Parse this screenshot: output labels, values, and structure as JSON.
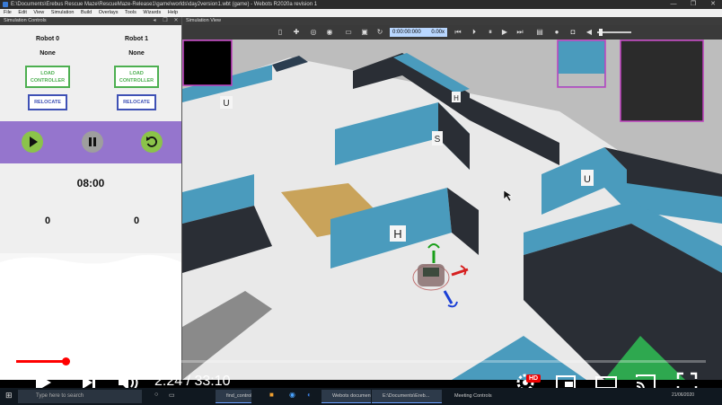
{
  "window": {
    "title": "E:\\Documents\\Erebus Rescue Maze\\RescueMaze-Release1\\game\\worlds\\day2version1.wbt (game) - Webots R2020a revision 1",
    "minimize": "—",
    "maximize": "❐",
    "close": "✕"
  },
  "menu": [
    "File",
    "Edit",
    "View",
    "Simulation",
    "Build",
    "Overlays",
    "Tools",
    "Wizards",
    "Help"
  ],
  "left_panel": {
    "header": "Simulation Controls",
    "robots": [
      {
        "title": "Robot 0",
        "name": "None",
        "load_label_1": "LOAD",
        "load_label_2": "CONTROLLER",
        "relocate_label": "RELOCATE",
        "score": "0"
      },
      {
        "title": "Robot 1",
        "name": "None",
        "load_label_1": "LOAD",
        "load_label_2": "CONTROLLER",
        "relocate_label": "RELOCATE",
        "score": "0"
      }
    ],
    "timer": "08:00",
    "colors": {
      "play_bar": "#9575cd",
      "play": "#8bc34a",
      "pause": "#9e9e9e",
      "reset": "#8bc34a"
    }
  },
  "view": {
    "header": "Simulation View",
    "sim_time": "0:00:00:000",
    "speed": "0.00x",
    "wall_letters": [
      "U",
      "H",
      "S",
      "U",
      "H"
    ]
  },
  "video": {
    "timecode": "2:24 / 33:10",
    "progress": 0.072,
    "hd_badge": "HD"
  },
  "taskbar": {
    "search_placeholder": "Type here to search",
    "tasks": [
      "find_controller.py -...",
      "Webots document...",
      "E:\\Documents\\Ereb...",
      "Meeting Controls"
    ],
    "clock": "21/06/2020"
  }
}
